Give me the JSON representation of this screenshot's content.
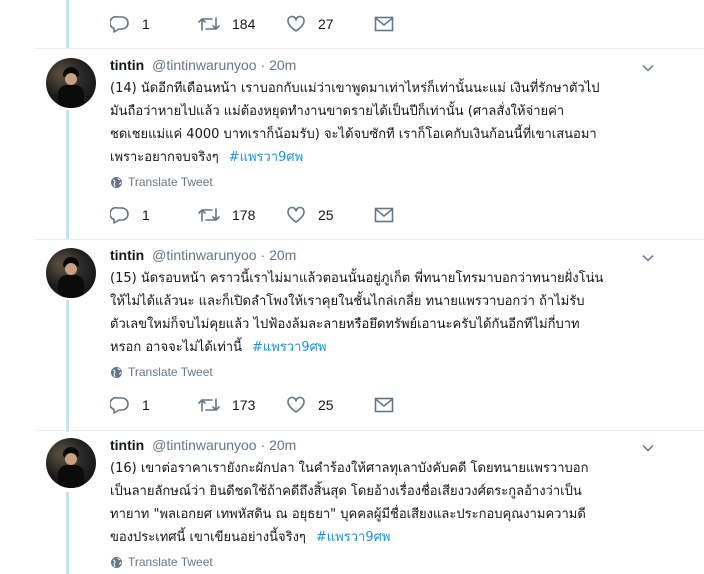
{
  "top_actions": {
    "reply": "1",
    "retweet": "184",
    "like": "27"
  },
  "tweets": [
    {
      "name": "tintin",
      "handle": "@tintinwarunyoo",
      "dot": "·",
      "time": "20m",
      "lines": [
        "(14) นัดอีกทีเดือนหน้า เราบอกกับแม่ว่าเขาพูดมาเท่าไหร่ก็เท่านั้นนะแม่ เงินที่รักษาตัวไป",
        "มันถือว่าหายไปแล้ว  แม่ต้องหยุดทำงานขาดรายได้เป็นปีก็เท่านั้น (ศาลสั่งให้จ่ายค่า",
        "ชดเชยแม่แค่ 4000 บาทเราก็น้อมรับ) จะได้จบซักที เราก็โอเคกับเงินก้อนนี้ที่เขาเสนอมา",
        "เพราะอยากจบจริงๆ"
      ],
      "hashtag": "#แพรวา9ศพ",
      "translate": "Translate Tweet",
      "reply": "1",
      "retweet": "178",
      "like": "25"
    },
    {
      "name": "tintin",
      "handle": "@tintinwarunyoo",
      "dot": "·",
      "time": "20m",
      "lines": [
        "(15) นัดรอบหน้า คราวนี้เราไม่มาแล้วตอนนั้นอยู่ภูเก็ต พี่ทนายโทรมาบอกว่าทนายฝั่งโน่น",
        "ให้ไม่ได้แล้วนะ และก็เปิดลำโพงให้เราคุยในชั้นไกล่เกลี่ย ทนายแพรวาบอกว่า ถ้าไม่รับ",
        "ตัวเลขใหม่ก็จบไม่คุยแล้ว ไปฟ้องล้มละลายหรือยึดทรัพย์เอานะครับได้กันอีกทีไม่กี่บาท",
        "หรอก อาจจะไม่ได้เท่านี้"
      ],
      "hashtag": "#แพรวา9ศพ",
      "translate": "Translate Tweet",
      "reply": "1",
      "retweet": "173",
      "like": "25"
    },
    {
      "name": "tintin",
      "handle": "@tintinwarunyoo",
      "dot": "·",
      "time": "20m",
      "lines": [
        "(16) เขาต่อราคาเรายังกะผักปลา ในคำร้องให้ศาลทุเลาบังคับคดี โดยทนายแพรวาบอก",
        "เป็นลายลักษณ์ว่า ยินดีชดใช้ถ้าคดีถึงสิ้นสุด โดยอ้างเรื่องชื่อเสียงวงศ์ตระกูลอ้างว่าเป็น",
        "ทายาท \"พลเอกยศ เทพหัสดิน ณ อยุธยา\" บุคคลผู้มีชื่อเสียงและประกอบคุณงามความดี",
        "ของประเทศนี้ เขาเขียนอย่างนี้จริงๆ"
      ],
      "hashtag": "#แพรวา9ศพ",
      "translate": "Translate Tweet"
    }
  ],
  "colors": {
    "thread_line": "#c4e4f5",
    "hashtag": "#1b95e0",
    "muted": "#657786",
    "divider": "#e6ecf0"
  },
  "icons": [
    "reply-icon",
    "retweet-icon",
    "like-icon",
    "message-icon",
    "globe-icon",
    "chevron-down-icon"
  ]
}
